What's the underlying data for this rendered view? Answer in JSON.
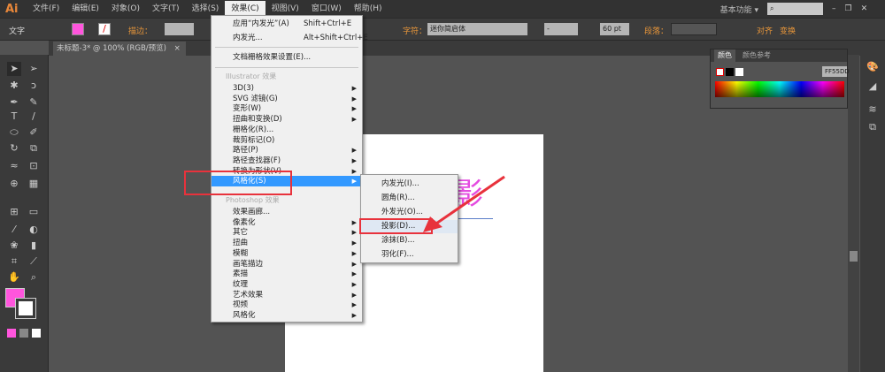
{
  "app": {
    "logo": "Ai",
    "workspace": "基本功能 ▾"
  },
  "menubar": [
    "文件(F)",
    "编辑(E)",
    "对象(O)",
    "文字(T)",
    "选择(S)",
    "效果(C)",
    "视图(V)",
    "窗口(W)",
    "帮助(H)"
  ],
  "control": {
    "label": "文字",
    "stroke_label": "描边：",
    "char_label": "字符：",
    "font": "迷你简启体",
    "style": "-",
    "size": "60 pt",
    "para_label": "段落：",
    "align_label": "对齐",
    "transform_label": "变换"
  },
  "document": {
    "tab": "未标题-3* @ 100% (RGB/预览)"
  },
  "effect_menu": {
    "apply_last": "应用“内发光”(A)",
    "apply_last_shortcut": "Shift+Ctrl+E",
    "last": "内发光...",
    "last_shortcut": "Alt+Shift+Ctrl+E",
    "raster_settings": "文档栅格效果设置(E)...",
    "illustrator_header": "Illustrator 效果",
    "illustrator_items": [
      "3D(3)",
      "SVG 滤镜(G)",
      "变形(W)",
      "扭曲和变换(D)",
      "栅格化(R)...",
      "裁剪标记(O)",
      "路径(P)",
      "路径查找器(F)",
      "转换为形状(V)",
      "风格化(S)"
    ],
    "photoshop_header": "Photoshop 效果",
    "photoshop_items": [
      "效果画廊...",
      "像素化",
      "其它",
      "扭曲",
      "模糊",
      "画笔描边",
      "素描",
      "纹理",
      "艺术效果",
      "视频",
      "风格化"
    ]
  },
  "stylize_submenu": [
    "内发光(I)...",
    "圆角(R)...",
    "外发光(O)...",
    "投影(D)...",
    "涂抹(B)...",
    "羽化(F)..."
  ],
  "color_panel": {
    "tabs": [
      "颜色",
      "颜色参考"
    ],
    "hex": "FF55DD"
  },
  "canvas_text": "影",
  "colors": {
    "fill": "#ff55dd",
    "highlight": "#3399ff",
    "annotation": "#e8323c"
  }
}
